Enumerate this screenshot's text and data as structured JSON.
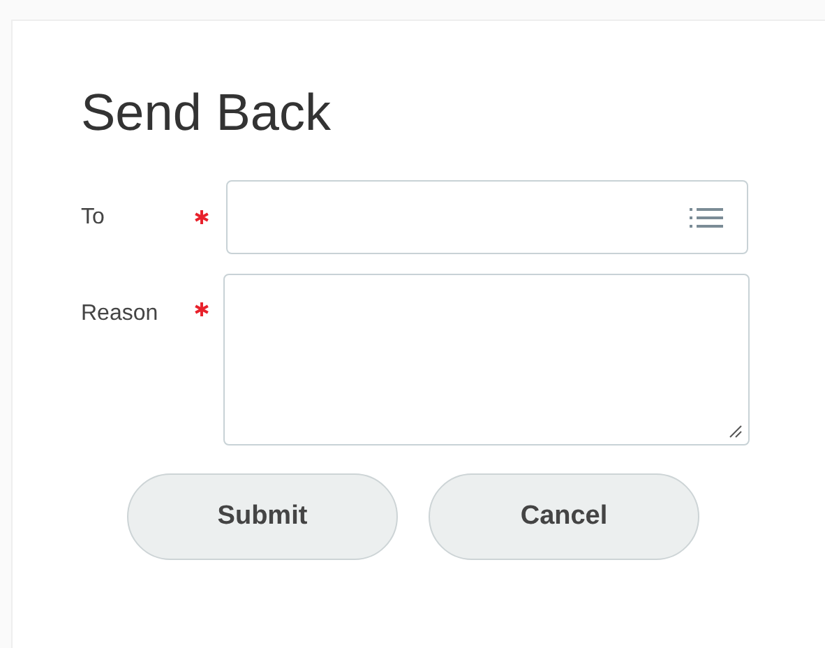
{
  "dialog": {
    "title": "Send Back"
  },
  "fields": [
    {
      "label": "To",
      "required": true,
      "kind": "select"
    },
    {
      "label": "Reason",
      "required": true,
      "kind": "textarea"
    }
  ],
  "buttons": [
    "Submit",
    "Cancel"
  ]
}
